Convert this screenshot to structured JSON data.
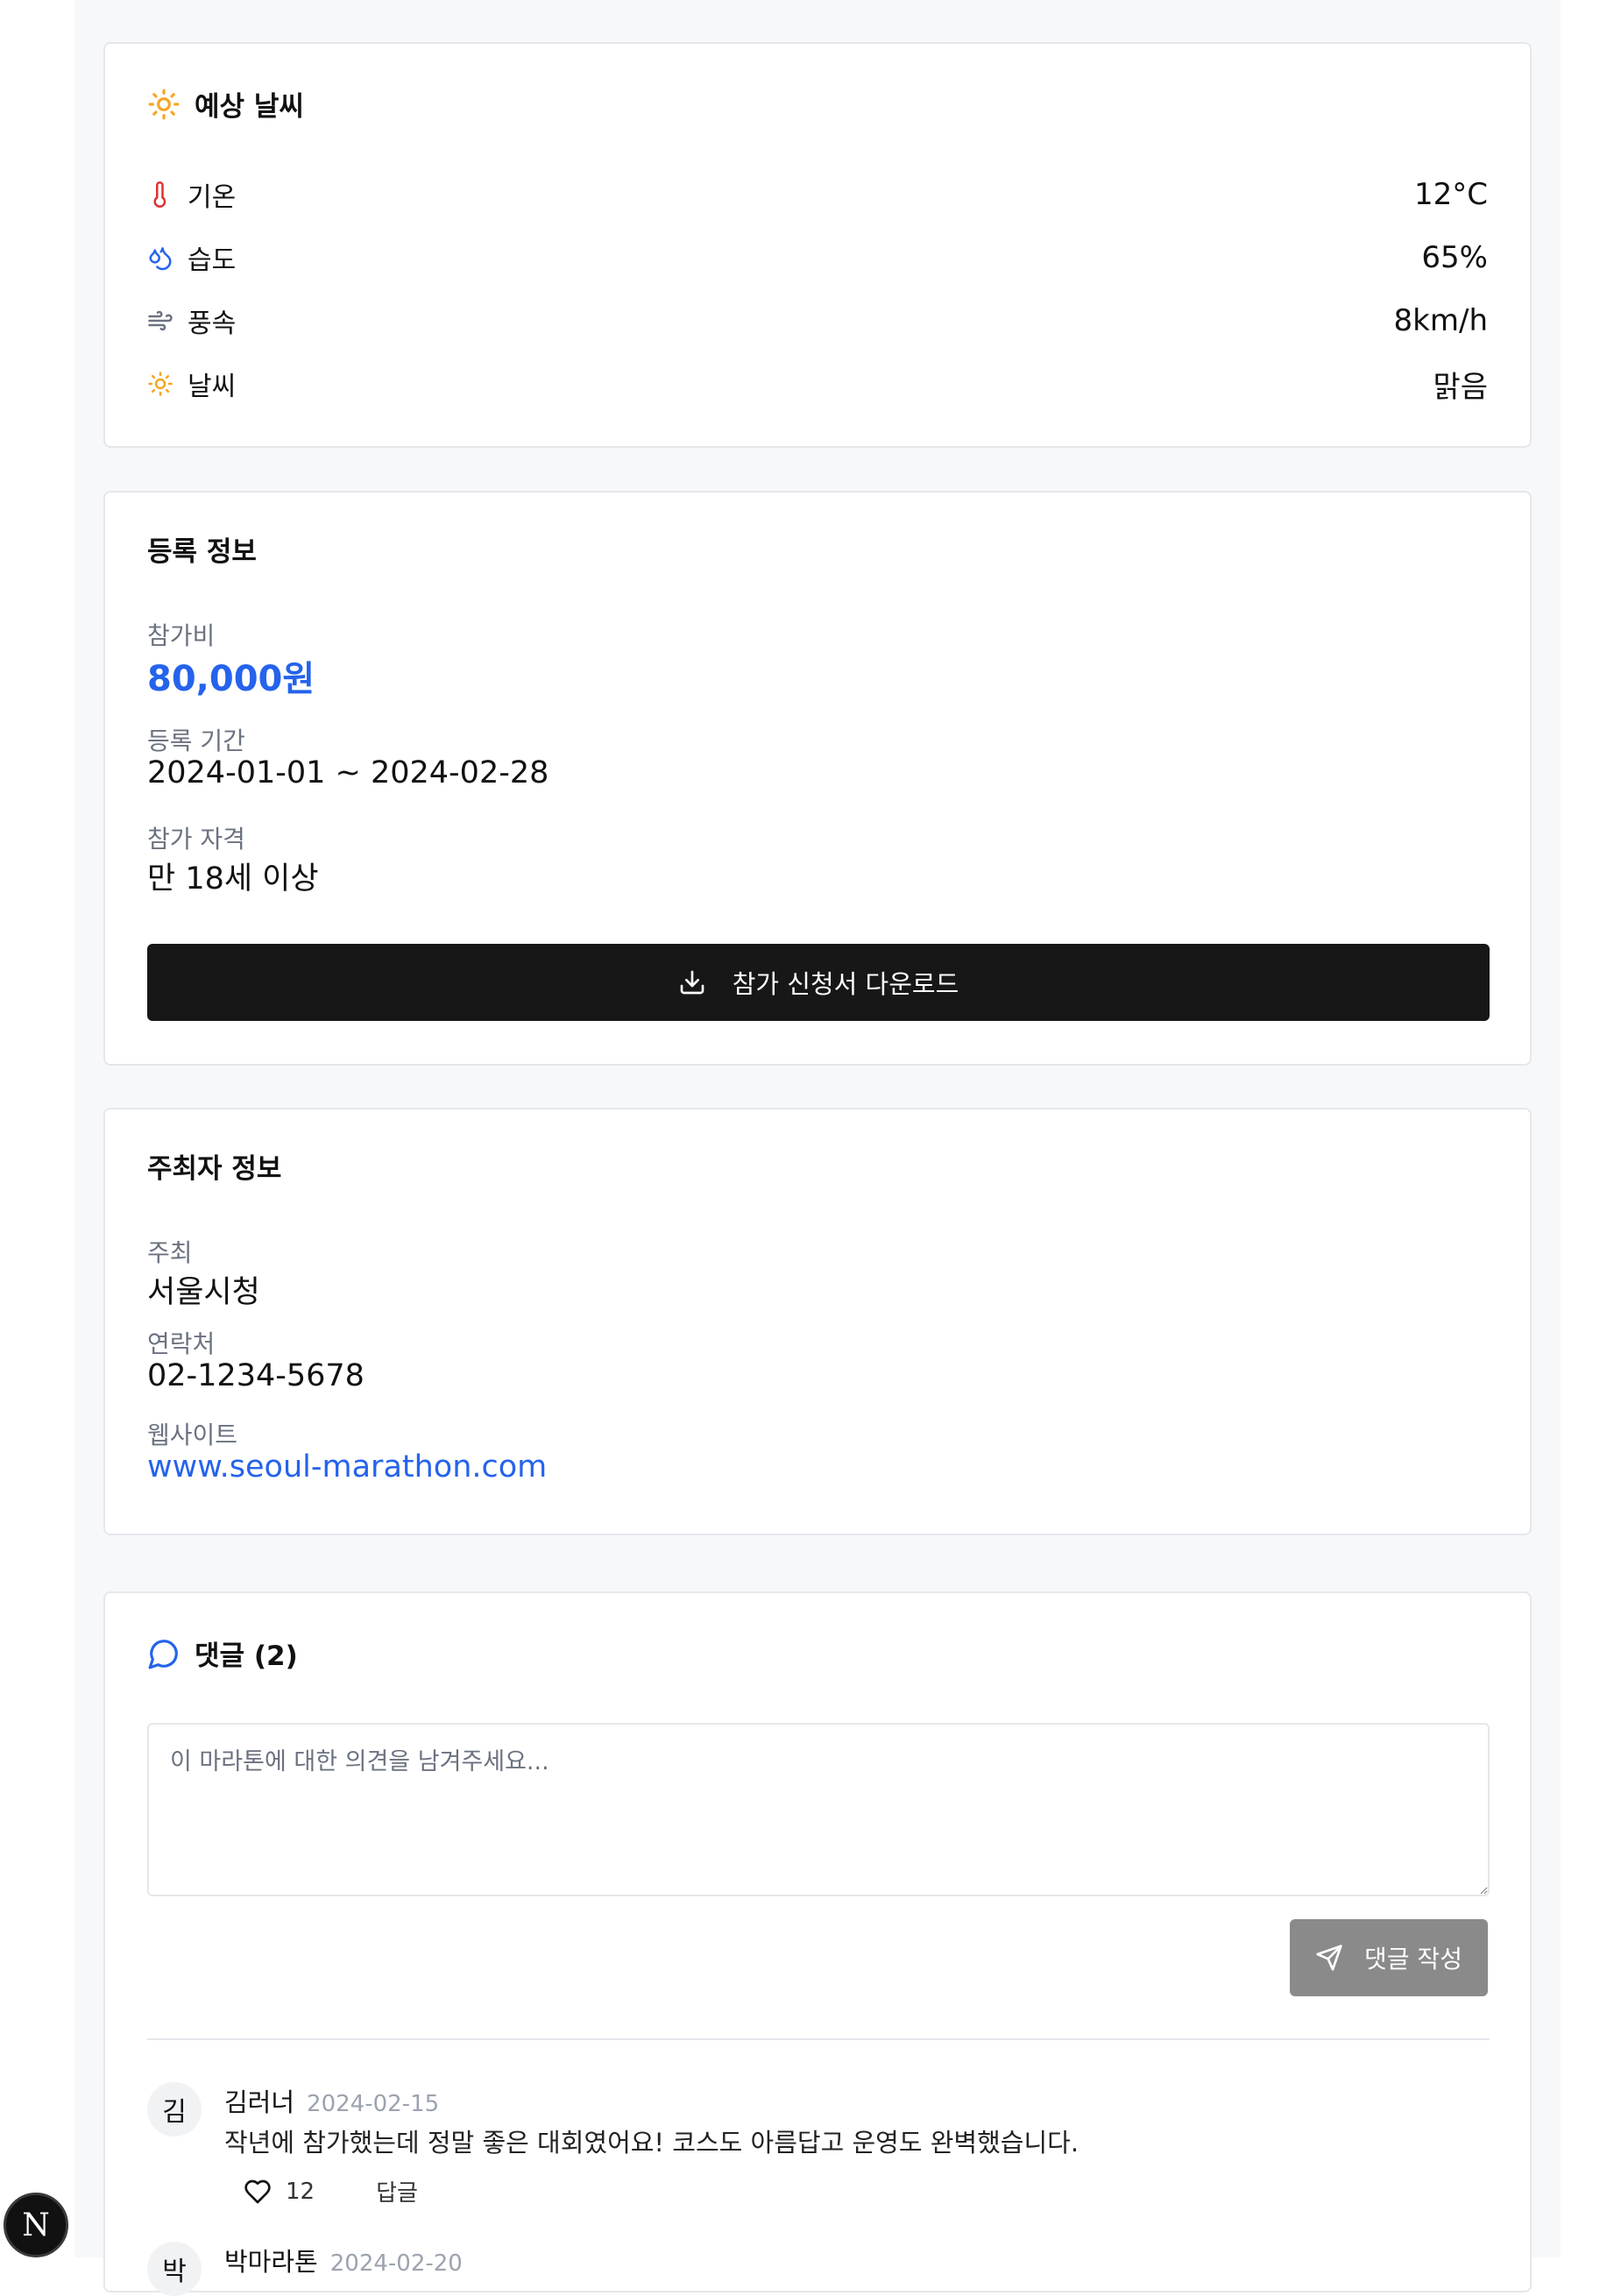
{
  "weather": {
    "title": "예상 날씨",
    "rows": [
      {
        "icon": "thermometer-icon",
        "label": "기온",
        "value": "12°C"
      },
      {
        "icon": "droplets-icon",
        "label": "습도",
        "value": "65%"
      },
      {
        "icon": "wind-icon",
        "label": "풍속",
        "value": "8km/h"
      },
      {
        "icon": "sun-icon",
        "label": "날씨",
        "value": "맑음"
      }
    ]
  },
  "registration": {
    "title": "등록 정보",
    "fee_label": "참가비",
    "fee_value": "80,000원",
    "period_label": "등록 기간",
    "period_value": "2024-01-01 ~ 2024-02-28",
    "eligibility_label": "참가 자격",
    "eligibility_value": "만 18세 이상",
    "download_label": "참가 신청서 다운로드"
  },
  "organizer": {
    "title": "주최자 정보",
    "host_label": "주최",
    "host_value": "서울시청",
    "contact_label": "연락처",
    "contact_value": "02-1234-5678",
    "website_label": "웹사이트",
    "website_value": "www.seoul-marathon.com"
  },
  "comments": {
    "title": "댓글 (2)",
    "placeholder": "이 마라톤에 대한 의견을 남겨주세요...",
    "submit_label": "댓글 작성",
    "items": [
      {
        "avatar": "김",
        "author": "김러너",
        "date": "2024-02-15",
        "text": "작년에 참가했는데 정말 좋은 대회였어요! 코스도 아름답고 운영도 완벽했습니다.",
        "likes": "12",
        "reply_label": "답글"
      },
      {
        "avatar": "박",
        "author": "박마라톤",
        "date": "2024-02-20"
      }
    ]
  },
  "badge": {
    "letter": "N"
  },
  "colors": {
    "accent": "#2563eb",
    "button_dark": "#171717",
    "button_disabled": "#8a8a8a",
    "sun": "#f5a623",
    "thermo": "#e03131"
  }
}
